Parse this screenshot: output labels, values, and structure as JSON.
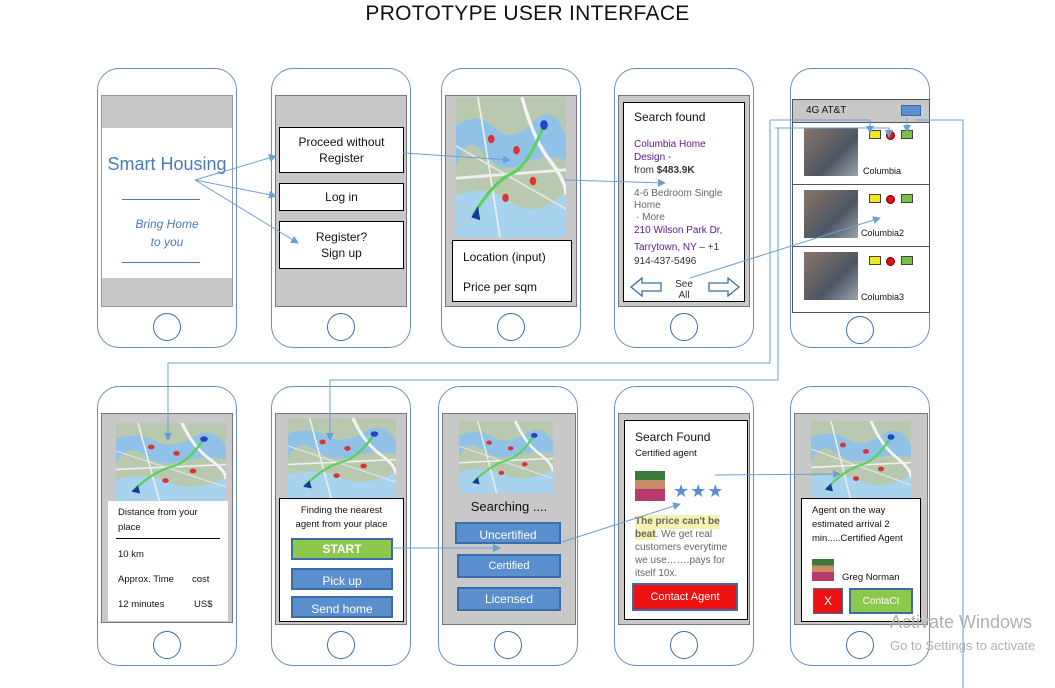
{
  "title": "PROTOTYPE USER INTERFACE",
  "screen1": {
    "app_name": "Smart Housing",
    "tagline_line1": "Bring Home",
    "tagline_line2": "to you"
  },
  "screen2": {
    "proceed_line1": "Proceed without",
    "proceed_line2": "Register",
    "login": "Log in",
    "register_line1": "Register?",
    "register_line2": "Sign up"
  },
  "screen3": {
    "location": "Location (input)",
    "price": "Price per sqm"
  },
  "screen4": {
    "heading": "Search found",
    "link_line1": "Columbia Home",
    "link_line2": "Design",
    "price_prefix": "from",
    "price": "$483.9K",
    "dash": "-",
    "desc_line1": "4-6 Bedroom Single",
    "desc_line2": "Home",
    "more": "· More",
    "address_line1": "210 Wilson Park Dr,",
    "address_line2": "Tarrytown, NY",
    "phone_line1": "– +1",
    "phone_line2": "914-437-5496",
    "see_all_line1": "See",
    "see_all_line2": "All"
  },
  "screen5": {
    "carrier": "4G AT&T",
    "items": [
      "Columbia",
      "Columbia2",
      "Columbia3"
    ]
  },
  "screen6": {
    "heading_line1": "Distance from your",
    "heading_line2": "place",
    "distance": "10 km",
    "time_label": "Approx. Time",
    "cost_label": "cost",
    "time_value": "12 minutes",
    "cost_value": "US$"
  },
  "screen7": {
    "heading_line1": "Finding the nearest",
    "heading_line2": "agent from your place",
    "start": "START",
    "pickup": "Pick up",
    "sendhome": "Send home"
  },
  "screen8": {
    "searching": "Searching ....",
    "uncertified": "Uncertified",
    "certified": "Certified",
    "licensed": "Licensed"
  },
  "screen9": {
    "heading": "Search Found",
    "sub": "Certified agent",
    "stars": "★★★",
    "quote_highlight_line1": "The price can't be",
    "quote_highlight_line2": "beat",
    "quote_rest_line2": ". We get real",
    "quote_line3": "customers  everytime",
    "quote_line4": "we use…….pays for",
    "quote_line5": "itself 10x.",
    "contact": "Contact Agent"
  },
  "screen10": {
    "msg_line1": "Agent on the way",
    "msg_line2": "estimated arrival 2",
    "msg_line3": "min.....Certified Agent",
    "agent_name": "Greg Norman",
    "close": "X",
    "contact": "ContaCt"
  },
  "watermark": {
    "line1": "Activate Windows",
    "line2": "Go to Settings to activate"
  },
  "colors": {
    "phone_border": "#6a8fb8",
    "button_blue": "#5a8fce",
    "start_green": "#8cc84b",
    "contact_red": "#ee1111",
    "link_purple": "#5b1a8c",
    "connector": "#6a9fd4"
  }
}
